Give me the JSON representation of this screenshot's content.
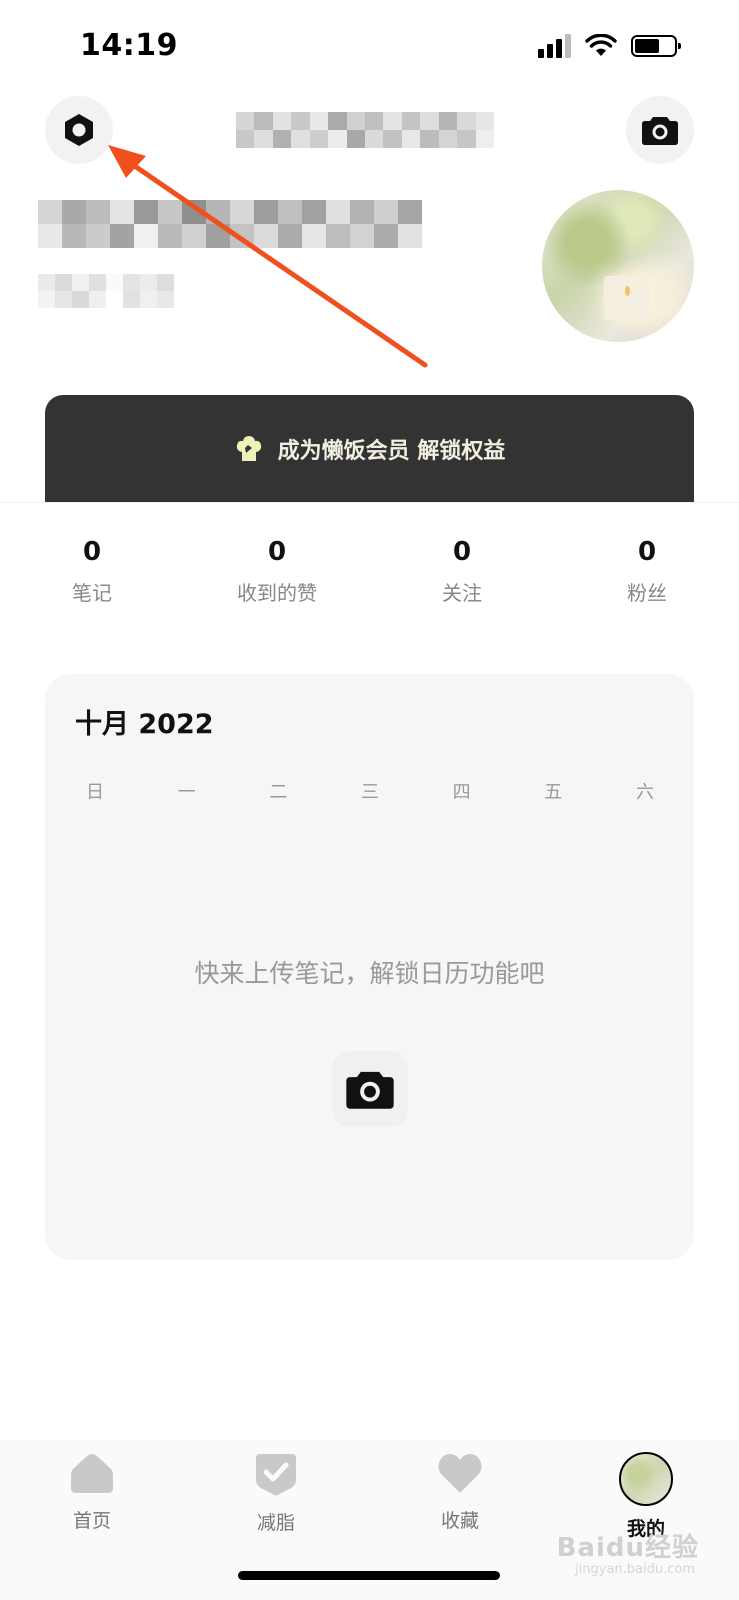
{
  "status_bar": {
    "time": "14:19"
  },
  "header": {
    "settings_icon": "settings-icon",
    "camera_icon": "camera-icon"
  },
  "profile": {
    "avatar_icon": "avatar-image"
  },
  "vip_banner": {
    "text": "成为懒饭会员 解锁权益",
    "icon": "chef-hat-icon"
  },
  "stats": [
    {
      "value": "0",
      "label": "笔记"
    },
    {
      "value": "0",
      "label": "收到的赞"
    },
    {
      "value": "0",
      "label": "关注"
    },
    {
      "value": "0",
      "label": "粉丝"
    }
  ],
  "calendar": {
    "title": "十月 2022",
    "weekdays": [
      "日",
      "一",
      "二",
      "三",
      "四",
      "五",
      "六"
    ],
    "empty_tip": "快来上传笔记，解锁日历功能吧"
  },
  "tabbar": {
    "items": [
      {
        "label": "首页",
        "icon": "home-icon"
      },
      {
        "label": "减脂",
        "icon": "check-badge-icon"
      },
      {
        "label": "收藏",
        "icon": "heart-icon"
      },
      {
        "label": "我的",
        "icon": "avatar-icon"
      }
    ],
    "active_index": 3
  },
  "watermark": {
    "text": "Baidu经验",
    "sub": "jingyan.baidu.com"
  }
}
